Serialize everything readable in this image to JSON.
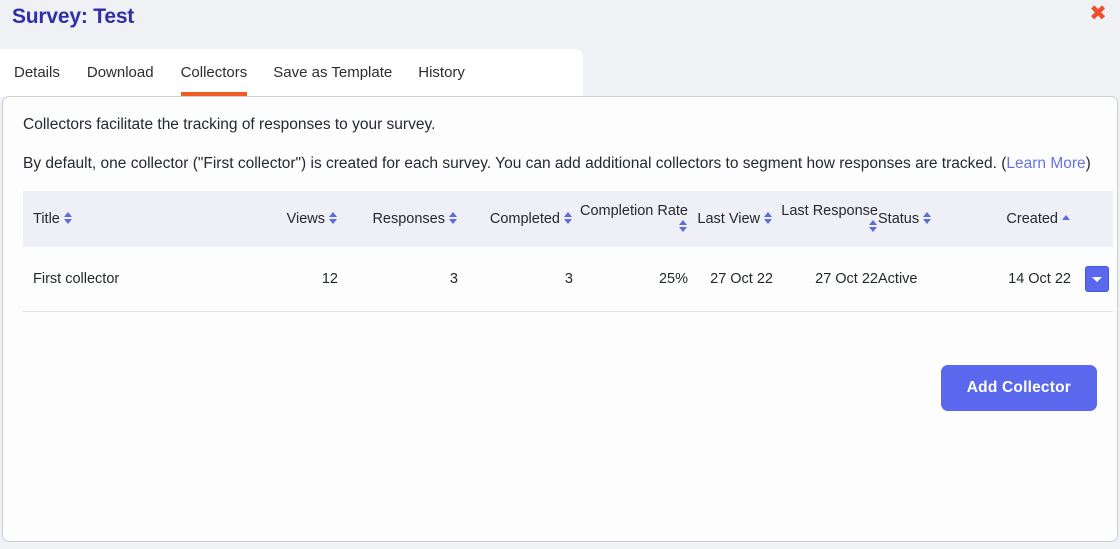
{
  "header": {
    "title": "Survey: Test",
    "close_label": "✖"
  },
  "tabs": [
    {
      "label": "Details",
      "active": false
    },
    {
      "label": "Download",
      "active": false
    },
    {
      "label": "Collectors",
      "active": true
    },
    {
      "label": "Save as Template",
      "active": false
    },
    {
      "label": "History",
      "active": false
    }
  ],
  "intro": {
    "line1": "Collectors facilitate the tracking of responses to your survey.",
    "line2_part1": "By default, one collector (\"First collector\") is created for each survey. You can add additional collectors to segment how responses are tracked. (",
    "learn_more": "Learn More",
    "line2_part2": ")"
  },
  "table": {
    "columns": [
      {
        "label": "Title",
        "sort": "both"
      },
      {
        "label": "Views",
        "sort": "both"
      },
      {
        "label": "Responses",
        "sort": "both"
      },
      {
        "label": "Completed",
        "sort": "both"
      },
      {
        "label": "Completion Rate",
        "sort": "both"
      },
      {
        "label": "Last View",
        "sort": "both"
      },
      {
        "label": "Last Response",
        "sort": "both"
      },
      {
        "label": "Status",
        "sort": "both"
      },
      {
        "label": "Created",
        "sort": "asc"
      }
    ],
    "rows": [
      {
        "title": "First collector",
        "views": "12",
        "responses": "3",
        "completed": "3",
        "completion_rate": "25%",
        "last_view": "27 Oct 22",
        "last_response": "27 Oct 22",
        "status": "Active",
        "created": "14 Oct 22",
        "action_icon": "chevron-down-icon"
      }
    ]
  },
  "actions": {
    "add_collector": "Add Collector"
  },
  "colors": {
    "accent_indigo": "#5968ec",
    "tab_active_orange": "#f15a22",
    "title_indigo": "#2e2fa8",
    "close_orange": "#ef4e2a",
    "link_indigo": "#6772e5",
    "page_bg": "#f0f1f5",
    "table_header_bg": "#eef0f5"
  }
}
